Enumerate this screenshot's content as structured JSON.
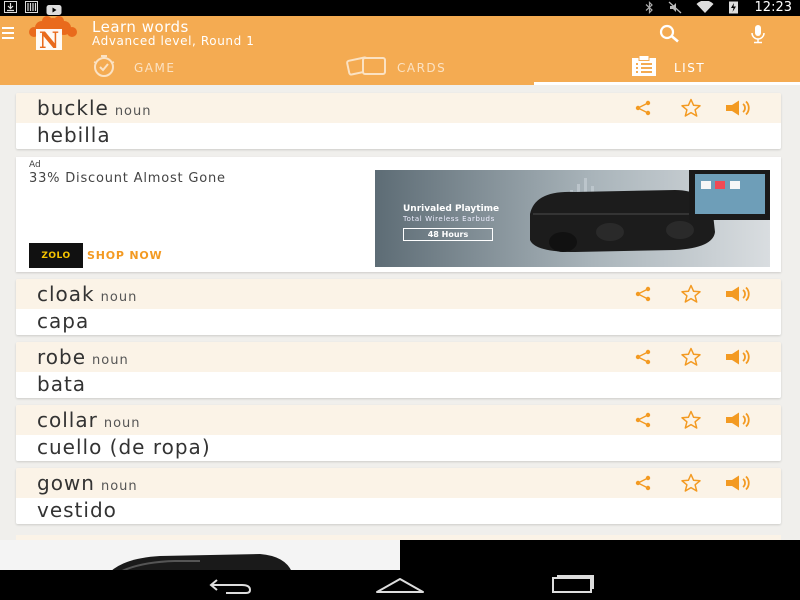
{
  "status_bar": {
    "time": "12:23",
    "left_icons": [
      "download-icon",
      "library-icon",
      "youtube-icon"
    ],
    "right_icons": [
      "bluetooth-icon",
      "mute-icon",
      "wifi-icon",
      "battery-charging-icon"
    ]
  },
  "app_bar": {
    "title": "Learn words",
    "subtitle": "Advanced level, Round 1",
    "logo_letter": "N"
  },
  "tabs": [
    {
      "label": "GAME",
      "icon": "stopwatch-icon",
      "active": false
    },
    {
      "label": "CARDS",
      "icon": "cards-icon",
      "active": false
    },
    {
      "label": "LIST",
      "icon": "clipboard-icon",
      "active": true
    }
  ],
  "words": [
    {
      "word": "buckle",
      "pos": "noun",
      "translation": "hebilla"
    },
    {
      "word": "cloak",
      "pos": "noun",
      "translation": "capa"
    },
    {
      "word": "robe",
      "pos": "noun",
      "translation": "bata"
    },
    {
      "word": "collar",
      "pos": "noun",
      "translation": "cuello (de ropa)"
    },
    {
      "word": "gown",
      "pos": "noun",
      "translation": "vestido"
    }
  ],
  "ad": {
    "tag": "Ad",
    "headline": "33% Discount Almost Gone",
    "brand": "ZOLO",
    "cta": "SHOP NOW",
    "image_title": "Unrivaled Playtime",
    "image_subtitle": "Total Wireless Earbuds",
    "image_badge": "48 Hours"
  },
  "colors": {
    "accent": "#f4ab52",
    "icon_orange": "#f39a22",
    "card_header": "#fbf3e7"
  }
}
